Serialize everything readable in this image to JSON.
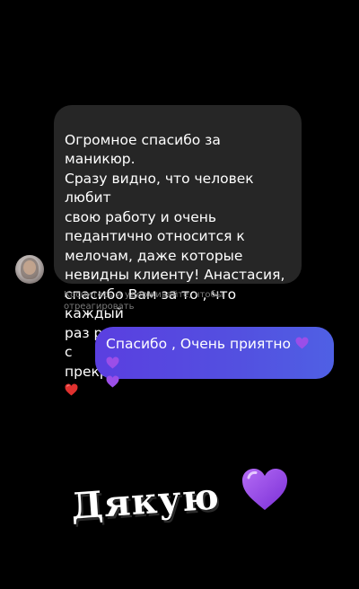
{
  "incoming_message": {
    "text": "Огромное спасибо за маникюр.\nСразу видно, что человек любит\nсвою работу и очень\nпедантично относится к\nмелочам, даже которые\nневидны клиенту! Анастасия,\nспасибо Вам за то , что каждый\nраз радуете! Отличный салон с\nпрекрасными мастерами",
    "emoji": "red-heart-emoji"
  },
  "hint": {
    "text": "Коснитесь и удерживайте, чтобы\nотреагировать"
  },
  "outgoing_message": {
    "text": "Спасибо , Очень приятно",
    "emoji": "purple-heart-emoji"
  },
  "sticker": {
    "text": "Дякую",
    "emoji": "purple-heart-emoji"
  },
  "colors": {
    "background": "#000000",
    "incoming_bubble": "#262626",
    "outgoing_bubble_start": "#5a3fe0",
    "outgoing_bubble_end": "#4f60e4",
    "hint_text": "#7a7a7a",
    "red_heart": "#e0312f",
    "purple_heart": "#9b4ee8"
  }
}
